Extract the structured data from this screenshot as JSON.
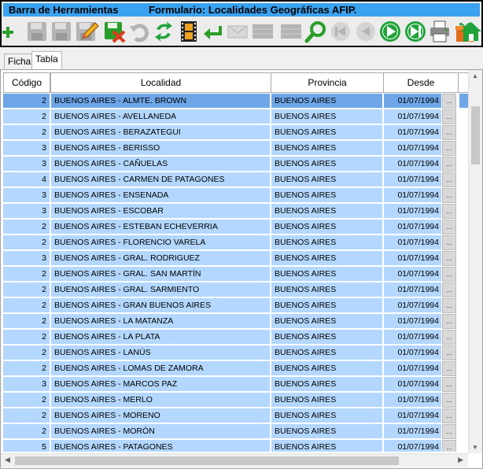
{
  "title_bar": {
    "left": "Barra de Herramientas",
    "right": "Formulario: Localidades Geográficas AFIP."
  },
  "toolbar": [
    {
      "name": "add-button",
      "icon": "plus-icon",
      "enabled": true,
      "color": "#2a9d2a"
    },
    {
      "name": "save-button",
      "icon": "floppy-icon",
      "enabled": false
    },
    {
      "name": "save-as-button",
      "icon": "floppy-icon",
      "enabled": false
    },
    {
      "name": "save-close-button",
      "icon": "floppy-icon",
      "enabled": false
    },
    {
      "name": "edit-button",
      "icon": "pencil-icon",
      "enabled": true
    },
    {
      "name": "delete-button",
      "icon": "floppy-delete-icon",
      "enabled": true,
      "color": "#e03a1c"
    },
    {
      "name": "undo-button",
      "icon": "undo-icon",
      "enabled": false
    },
    {
      "name": "refresh-button",
      "icon": "refresh-icon",
      "enabled": true,
      "color": "#1fa33a"
    },
    {
      "name": "filmstrip-button",
      "icon": "film-icon",
      "enabled": true
    },
    {
      "name": "enter-button",
      "icon": "return-arrow-icon",
      "enabled": true,
      "color": "#2a9d2a"
    },
    {
      "name": "mail-button",
      "icon": "envelope-icon",
      "enabled": false
    },
    {
      "name": "grid-button-1",
      "icon": "grid-icon",
      "enabled": false
    },
    {
      "name": "grid-button-2",
      "icon": "grid-icon",
      "enabled": false
    },
    {
      "name": "search-button",
      "icon": "magnifier-icon",
      "enabled": true,
      "color": "#2a9d2a"
    },
    {
      "name": "first-record-button",
      "icon": "first-icon",
      "enabled": false
    },
    {
      "name": "previous-record-button",
      "icon": "previous-icon",
      "enabled": false
    },
    {
      "name": "next-record-button",
      "icon": "play-icon",
      "enabled": true,
      "color": "#1fa33a"
    },
    {
      "name": "last-record-button",
      "icon": "last-icon",
      "enabled": true,
      "color": "#1fa33a"
    },
    {
      "name": "print-button",
      "icon": "printer-icon",
      "enabled": true
    },
    {
      "name": "gift-button",
      "icon": "gift-icon",
      "enabled": true,
      "color": "#1fa33a"
    },
    {
      "name": "home-button",
      "icon": "home-icon",
      "enabled": true,
      "color": "#1fa33a"
    }
  ],
  "tabs": [
    {
      "label": "Ficha",
      "active": false
    },
    {
      "label": "Tabla",
      "active": true
    }
  ],
  "columns": [
    "Código",
    "Localidad",
    "Provincia",
    "Desde"
  ],
  "rows": [
    {
      "code": "2",
      "localidad": "BUENOS AIRES - ALMTE. BROWN",
      "provincia": "BUENOS AIRES",
      "desde": "01/07/1994",
      "selected": true
    },
    {
      "code": "2",
      "localidad": "BUENOS AIRES - AVELLANEDA",
      "provincia": "BUENOS AIRES",
      "desde": "01/07/1994"
    },
    {
      "code": "2",
      "localidad": "BUENOS AIRES - BERAZATEGUI",
      "provincia": "BUENOS AIRES",
      "desde": "01/07/1994"
    },
    {
      "code": "3",
      "localidad": "BUENOS AIRES - BERISSO",
      "provincia": "BUENOS AIRES",
      "desde": "01/07/1994"
    },
    {
      "code": "3",
      "localidad": "BUENOS AIRES - CAÑUELAS",
      "provincia": "BUENOS AIRES",
      "desde": "01/07/1994"
    },
    {
      "code": "4",
      "localidad": "BUENOS AIRES - CARMEN DE PATAGONES",
      "provincia": "BUENOS AIRES",
      "desde": "01/07/1994"
    },
    {
      "code": "3",
      "localidad": "BUENOS AIRES - ENSENADA",
      "provincia": "BUENOS AIRES",
      "desde": "01/07/1994"
    },
    {
      "code": "3",
      "localidad": "BUENOS AIRES - ESCOBAR",
      "provincia": "BUENOS AIRES",
      "desde": "01/07/1994"
    },
    {
      "code": "2",
      "localidad": "BUENOS AIRES - ESTEBAN ECHEVERRIA",
      "provincia": "BUENOS AIRES",
      "desde": "01/07/1994"
    },
    {
      "code": "2",
      "localidad": "BUENOS AIRES - FLORENCIO VARELA",
      "provincia": "BUENOS AIRES",
      "desde": "01/07/1994"
    },
    {
      "code": "3",
      "localidad": "BUENOS AIRES - GRAL. RODRIGUEZ",
      "provincia": "BUENOS AIRES",
      "desde": "01/07/1994"
    },
    {
      "code": "2",
      "localidad": "BUENOS AIRES - GRAL. SAN MARTÍN",
      "provincia": "BUENOS AIRES",
      "desde": "01/07/1994"
    },
    {
      "code": "2",
      "localidad": "BUENOS AIRES - GRAL. SARMIENTO",
      "provincia": "BUENOS AIRES",
      "desde": "01/07/1994"
    },
    {
      "code": "2",
      "localidad": "BUENOS AIRES - GRAN BUENOS AIRES",
      "provincia": "BUENOS AIRES",
      "desde": "01/07/1994"
    },
    {
      "code": "2",
      "localidad": "BUENOS AIRES - LA MATANZA",
      "provincia": "BUENOS AIRES",
      "desde": "01/07/1994"
    },
    {
      "code": "2",
      "localidad": "BUENOS AIRES - LA PLATA",
      "provincia": "BUENOS AIRES",
      "desde": "01/07/1994"
    },
    {
      "code": "2",
      "localidad": "BUENOS AIRES - LANÚS",
      "provincia": "BUENOS AIRES",
      "desde": "01/07/1994"
    },
    {
      "code": "2",
      "localidad": "BUENOS AIRES - LOMAS DE ZAMORA",
      "provincia": "BUENOS AIRES",
      "desde": "01/07/1994"
    },
    {
      "code": "3",
      "localidad": "BUENOS AIRES - MARCOS PAZ",
      "provincia": "BUENOS AIRES",
      "desde": "01/07/1994"
    },
    {
      "code": "2",
      "localidad": "BUENOS AIRES - MERLO",
      "provincia": "BUENOS AIRES",
      "desde": "01/07/1994"
    },
    {
      "code": "2",
      "localidad": "BUENOS AIRES - MORENO",
      "provincia": "BUENOS AIRES",
      "desde": "01/07/1994"
    },
    {
      "code": "2",
      "localidad": "BUENOS AIRES - MORÓN",
      "provincia": "BUENOS AIRES",
      "desde": "01/07/1994"
    },
    {
      "code": "5",
      "localidad": "BUENOS AIRES - PATAGONES",
      "provincia": "BUENOS AIRES",
      "desde": "01/07/1994"
    }
  ],
  "row_button_label": "...",
  "colors": {
    "title_bar": "#3aa2f0",
    "row_bg": "#b3d7ff",
    "row_selected": "#6fa6e8"
  }
}
